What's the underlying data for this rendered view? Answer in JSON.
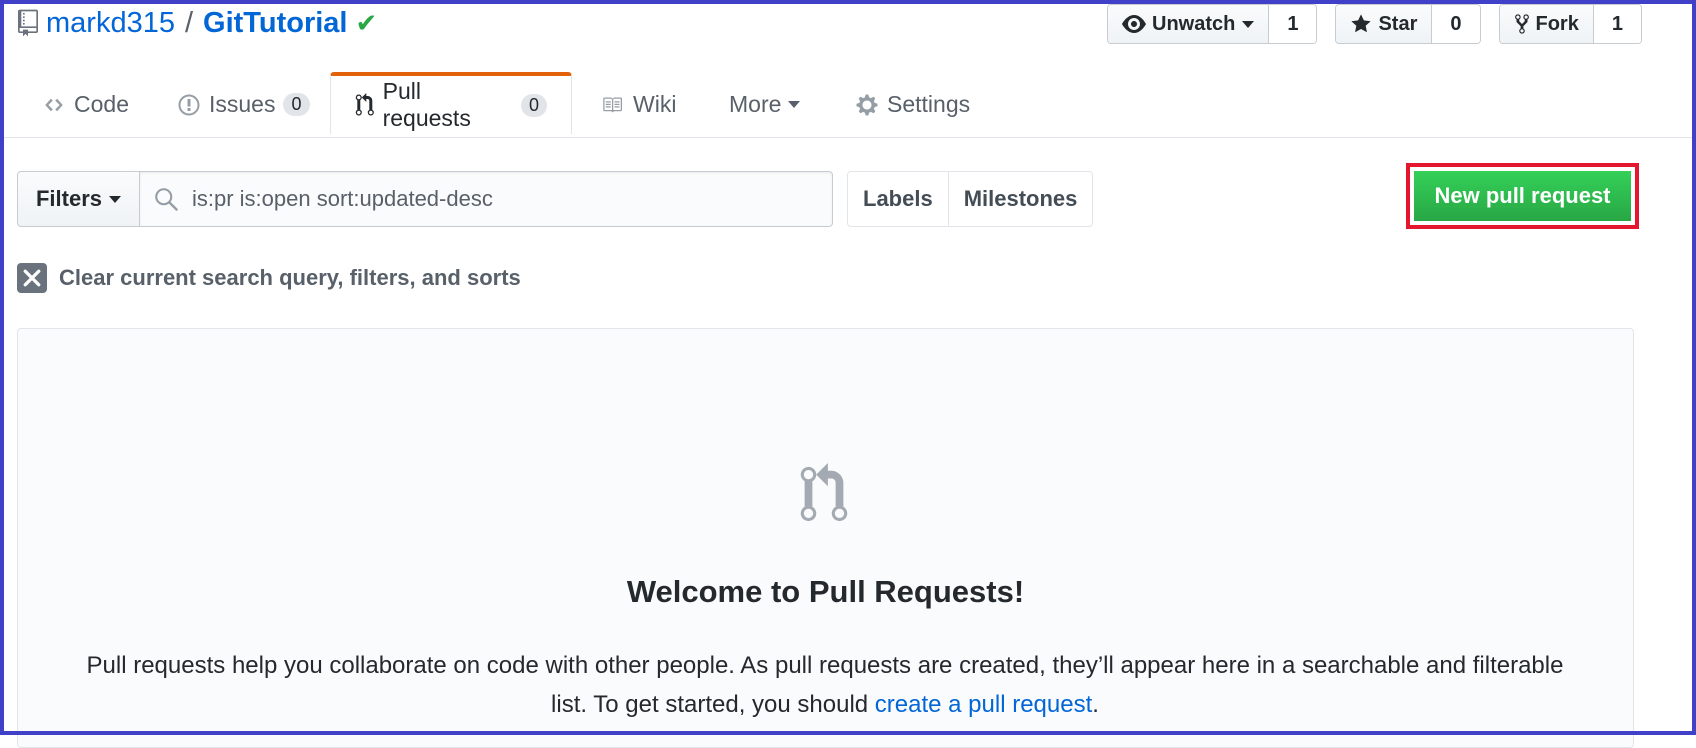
{
  "repo": {
    "owner": "markd315",
    "separator": "/",
    "name": "GitTutorial",
    "verified_icon": "check-icon"
  },
  "actions": {
    "watch": {
      "label": "Unwatch",
      "count": "1"
    },
    "star": {
      "label": "Star",
      "count": "0"
    },
    "fork": {
      "label": "Fork",
      "count": "1"
    }
  },
  "tabs": [
    {
      "label": "Code",
      "icon": "code-icon"
    },
    {
      "label": "Issues",
      "counter": "0",
      "icon": "issue-icon"
    },
    {
      "label": "Pull requests",
      "counter": "0",
      "icon": "pull-request-icon",
      "selected": true
    },
    {
      "label": "Wiki",
      "icon": "book-icon"
    },
    {
      "label": "More",
      "icon": "chevron-down-icon"
    },
    {
      "label": "Settings",
      "icon": "gear-icon"
    }
  ],
  "filters": {
    "filters_label": "Filters",
    "search_value": "is:pr is:open sort:updated-desc",
    "labels_label": "Labels",
    "milestones_label": "Milestones",
    "new_pr_label": "New pull request",
    "clear_label": "Clear current search query, filters, and sorts"
  },
  "blankslate": {
    "title": "Welcome to Pull Requests!",
    "text_before": "Pull requests help you collaborate on code with other people. As pull requests are created, they’ll appear here in a searchable and filterable list. To get started, you should ",
    "link": "create a pull request",
    "text_after": "."
  },
  "colors": {
    "link": "#0366d6",
    "primary_button": "#2cbe4e",
    "tab_accent": "#e36209",
    "highlight_outline": "#e4162e",
    "frame": "#4040c8"
  }
}
